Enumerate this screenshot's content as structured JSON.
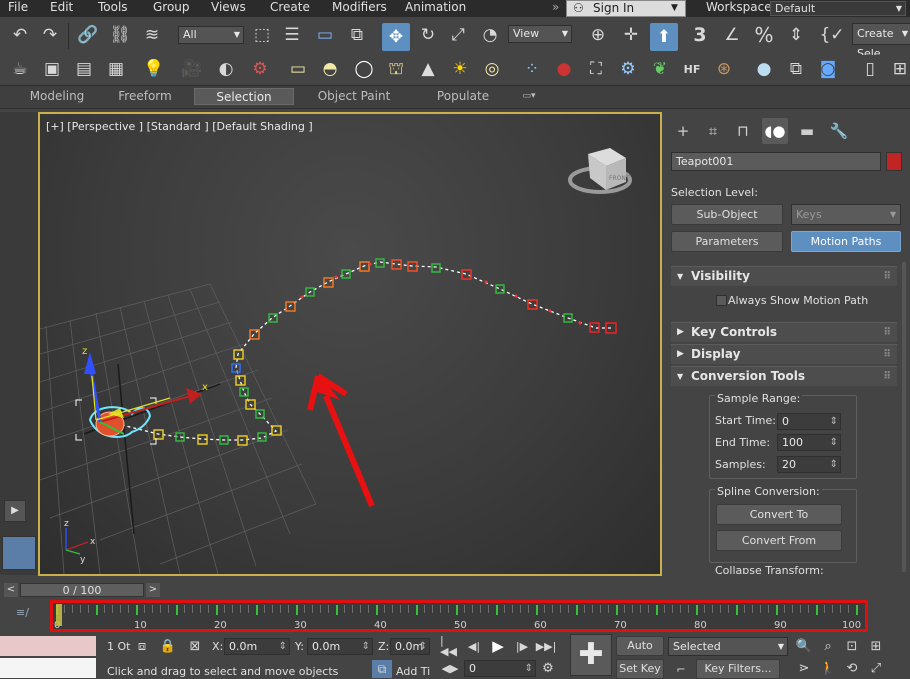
{
  "menu": [
    "File",
    "Edit",
    "Tools",
    "Group",
    "Views",
    "Create",
    "Modifiers",
    "Animation"
  ],
  "signin": {
    "label": "Sign In"
  },
  "workspaces": {
    "label": "Workspaces:",
    "value": "Default"
  },
  "toolbar": {
    "selection_filter": "All",
    "ref_coord": "View",
    "named_selection": "Create Sele",
    "snap_label": "3",
    "percent_icon": "%"
  },
  "ribbon": {
    "tabs": [
      "Modeling",
      "Freeform",
      "Selection",
      "Object Paint",
      "Populate"
    ],
    "active": "Selection"
  },
  "viewport": {
    "label": "[+] [Perspective ] [Standard ] [Default Shading ]",
    "cube_face": "FRONT",
    "axis_x": "x",
    "axis_y": "y",
    "axis_z": "z"
  },
  "panel": {
    "object_name": "Teapot001",
    "object_color": "#c02424",
    "selection_level_label": "Selection Level:",
    "subobject_btn": "Sub-Object",
    "keys_dropdown": "Keys",
    "parameters_btn": "Parameters",
    "motion_paths_btn": "Motion Paths",
    "rollouts": {
      "visibility": "Visibility",
      "always_show": "Always Show Motion Path",
      "key_controls": "Key Controls",
      "display": "Display",
      "conversion_tools": "Conversion Tools",
      "sample_range": "Sample Range:",
      "start_time_label": "Start Time:",
      "start_time": "0",
      "end_time_label": "End Time:",
      "end_time": "100",
      "samples_label": "Samples:",
      "samples": "20",
      "spline_conversion": "Spline Conversion:",
      "convert_to": "Convert To",
      "convert_from": "Convert From",
      "collapse_transform": "Collapse Transform:"
    }
  },
  "timeslider": {
    "label": "0 / 100",
    "prev": "<",
    "next": ">"
  },
  "trackbar": {
    "labels": [
      "0",
      "10",
      "20",
      "30",
      "40",
      "50",
      "60",
      "70",
      "80",
      "90",
      "100"
    ],
    "key_frames": [
      0,
      5,
      10,
      15,
      20,
      25,
      30,
      35,
      40,
      45,
      50,
      55,
      60,
      65,
      70,
      75,
      80,
      85,
      90,
      95,
      100
    ]
  },
  "status": {
    "selected_count": "1 Ot",
    "message": "Click and drag to select and move objects",
    "x_label": "X:",
    "x_value": "0.0m",
    "y_label": "Y:",
    "y_value": "0.0m",
    "z_label": "Z:",
    "z_value": "0.0m",
    "add_time_tag": "Add Tir",
    "frame_value": "0",
    "auto_key": "Auto Key",
    "set_key": "Set Key",
    "selected_dropdown": "Selected",
    "key_filters": "Key Filters..."
  }
}
